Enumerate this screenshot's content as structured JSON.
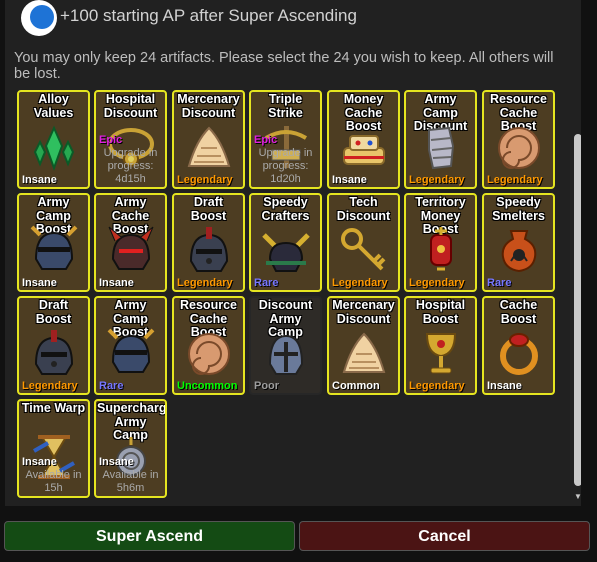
{
  "option": {
    "label": "+100 starting AP after Super Ascending"
  },
  "notice": "You may only keep 24 artifacts.  Please select the 24 you wish to keep.  All others will be lost.",
  "rarity_colors": {
    "Insane": "#ffffff",
    "Legendary": "#ff9900",
    "Rare": "#7777ff",
    "Uncommon": "#00ff00",
    "Common": "#ffffff",
    "Poor": "#9d9d9d"
  },
  "artifacts": [
    {
      "name": "Alloy Values",
      "rarity": "Insane",
      "icon": "crystals-icon"
    },
    {
      "name": "Hospital Discount",
      "rarity": "Epic",
      "icon": "amulet-icon",
      "status": "Upgrade in progress: 4d15h"
    },
    {
      "name": "Mercenary Discount",
      "rarity": "Legendary",
      "icon": "shell-icon"
    },
    {
      "name": "Triple Strike",
      "rarity": "Epic",
      "icon": "crossbow-icon",
      "status": "Upgrade in progress: 1d20h"
    },
    {
      "name": "Money Cache Boost",
      "rarity": "Insane",
      "icon": "cake-icon"
    },
    {
      "name": "Army Camp Discount",
      "rarity": "Legendary",
      "icon": "gauntlet-icon"
    },
    {
      "name": "Resource Cache Boost",
      "rarity": "Legendary",
      "icon": "nautilus-icon"
    },
    {
      "name": "Army Camp Boost",
      "rarity": "Insane",
      "icon": "helmet-icon"
    },
    {
      "name": "Army Cache Boost",
      "rarity": "Insane",
      "icon": "demon-helmet-icon"
    },
    {
      "name": "Draft Boost",
      "rarity": "Legendary",
      "icon": "gladiator-helmet-icon"
    },
    {
      "name": "Speedy Crafters",
      "rarity": "Rare",
      "icon": "samurai-helmet-icon"
    },
    {
      "name": "Tech Discount",
      "rarity": "Legendary",
      "icon": "key-icon"
    },
    {
      "name": "Territory Money Boost",
      "rarity": "Legendary",
      "icon": "lantern-icon"
    },
    {
      "name": "Speedy Smelters",
      "rarity": "Rare",
      "icon": "vase-icon"
    },
    {
      "name": "Draft Boost",
      "rarity": "Legendary",
      "icon": "gladiator-helmet-icon"
    },
    {
      "name": "Army Camp Boost",
      "rarity": "Rare",
      "icon": "helmet-icon"
    },
    {
      "name": "Resource Cache Boost",
      "rarity": "Uncommon",
      "icon": "nautilus-icon"
    },
    {
      "name": "Discount Army Camp",
      "rarity": "Poor",
      "icon": "knight-helmet-icon"
    },
    {
      "name": "Mercenary Discount",
      "rarity": "Common",
      "icon": "shell-icon"
    },
    {
      "name": "Hospital Boost",
      "rarity": "Legendary",
      "icon": "goblet-icon"
    },
    {
      "name": "Cache Boost",
      "rarity": "Insane",
      "icon": "ring-icon"
    },
    {
      "name": "Time Warp",
      "rarity": "Insane",
      "icon": "hourglass-icon",
      "status": "Available in 15h"
    },
    {
      "name": "Supercharge Army Camp",
      "rarity": "Insane",
      "icon": "coin-icon",
      "status": "Available in 5h6m"
    }
  ],
  "buttons": {
    "super_ascend": "Super Ascend",
    "cancel": "Cancel"
  }
}
